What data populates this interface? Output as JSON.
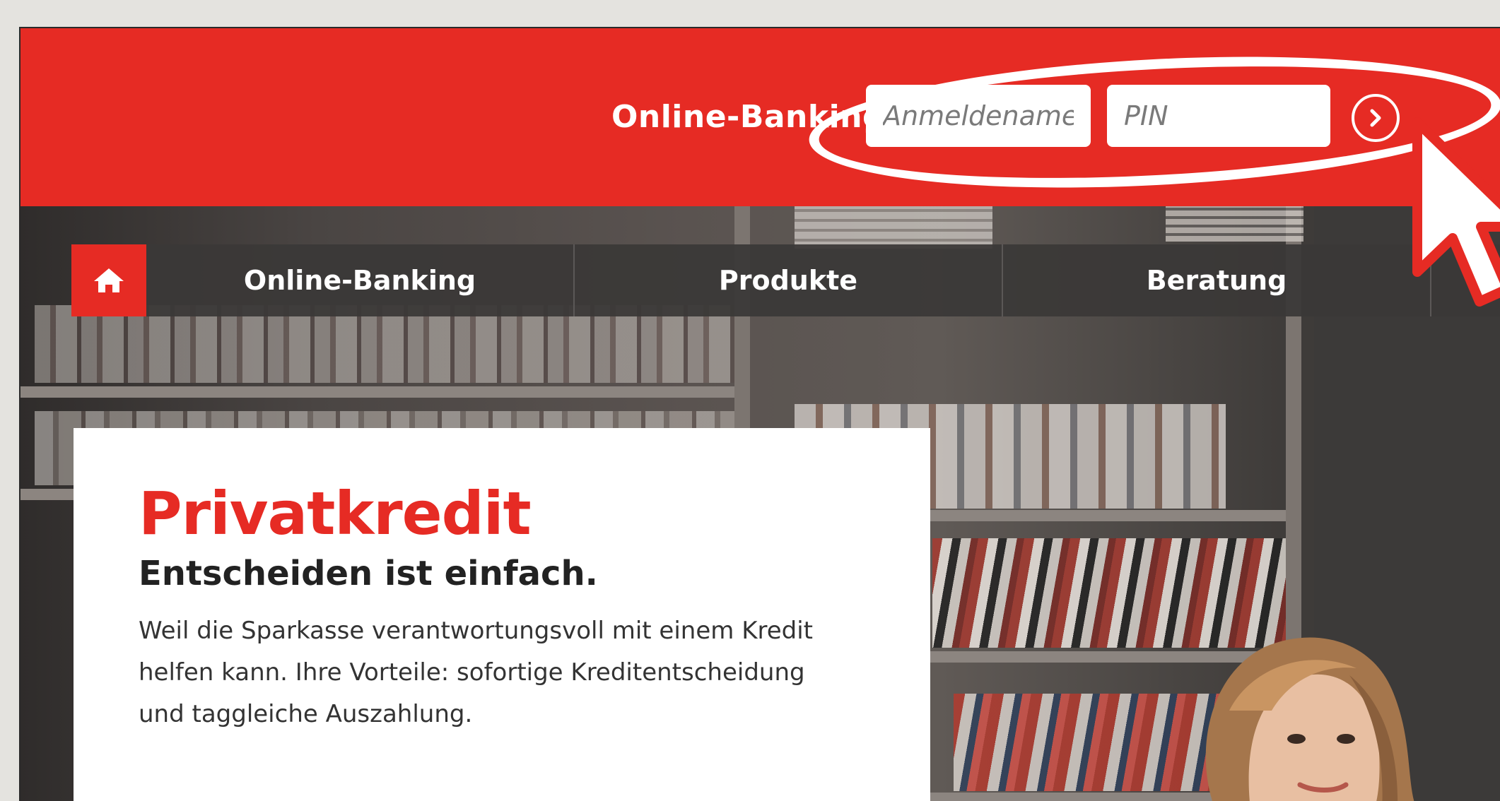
{
  "header": {
    "login_label": "Online-Banking",
    "username_placeholder": "Anmeldename",
    "pin_placeholder": "PIN",
    "submit_icon": "chevron-right-circle-icon",
    "brand_color": "#e62b24"
  },
  "nav": {
    "home_icon": "home-icon",
    "items": [
      {
        "label": "Online-Banking"
      },
      {
        "label": "Produkte"
      },
      {
        "label": "Beratung"
      }
    ]
  },
  "promo": {
    "title": "Privatkredit",
    "subtitle": "Entscheiden ist einfach.",
    "text": "Weil die Sparkasse verantwortungsvoll mit einem Kredit helfen kann. Ihre Vorteile: sofortige Kreditentscheidung und taggleiche Auszahlung."
  }
}
